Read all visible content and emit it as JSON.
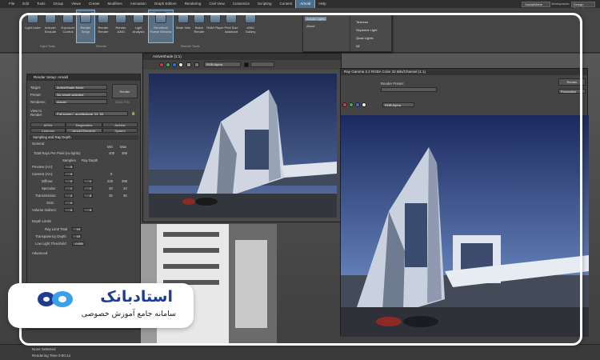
{
  "menubar": {
    "items": [
      "File",
      "Edit",
      "Tools",
      "Group",
      "Views",
      "Create",
      "Modifiers",
      "Animation",
      "Graph Editors",
      "Rendering",
      "Civil View",
      "Customize",
      "Scripting",
      "Content",
      "Arnold",
      "Help"
    ],
    "active_item": "Arnold",
    "user": "VastakMahe",
    "workspaces_label": "Workspaces:",
    "workspace": "Design Default"
  },
  "ribbon": {
    "buttons": [
      "Light Lister",
      "Include/ Exclude",
      "Exposure Control",
      "Render Setup",
      "Render Render",
      "Render A360",
      "Light Analysis",
      "Rendered Frame Window",
      "State Sets",
      "Batch Render",
      "RAM Player",
      "Print Size Assistant",
      "A360 Gallery"
    ],
    "groups": [
      "Light Tools",
      "Render",
      "Render Tools"
    ]
  },
  "arnold_menu": {
    "left": [
      "Arnold Lights",
      "About"
    ],
    "right": [
      "Textures",
      "Skydome Light",
      "Quad Lights",
      "All"
    ]
  },
  "render_setup": {
    "title": "Render Setup: Arnold",
    "target_label": "Target:",
    "target_value": "ActiveShade Mode",
    "preset_label": "Preset:",
    "preset_value": "No preset selected",
    "renderer_label": "Renderer:",
    "renderer_value": "Arnold",
    "render_button": "Render",
    "save_file": "Save File",
    "view_label": "View to Render:",
    "view_value": "Full screen - architectural_01_00",
    "tabs_row1": [
      "AOVs",
      "Diagnostics",
      "Archive"
    ],
    "tabs_row2": [
      "Common",
      "Arnold Renderer",
      "System"
    ],
    "sampling_header": "Sampling and Ray Depth",
    "general_label": "General",
    "min_label": "Min",
    "max_label": "Max",
    "total_rays_label": "Total Rays Per Pixel (no lights)",
    "total_min": "400",
    "total_max": "486",
    "samples_label": "Samples",
    "ray_depth_label": "Ray Depth",
    "rows": [
      {
        "label": "Preview (AA):",
        "samples": "-3",
        "depth": ""
      },
      {
        "label": "Camera (AA):",
        "samples": "3",
        "depth": "",
        "extra": "9"
      },
      {
        "label": "Diffuse:",
        "samples": "2",
        "depth": "1",
        "a": "225",
        "b": "396"
      },
      {
        "label": "Specular:",
        "samples": "1",
        "depth": "1",
        "a": "49",
        "b": "44"
      },
      {
        "label": "Transmission:",
        "samples": "2",
        "depth": "8",
        "a": "36",
        "b": "36"
      },
      {
        "label": "SSS:",
        "samples": "2",
        "depth": "",
        "a": "",
        "b": ""
      },
      {
        "label": "Volume Indirect:",
        "samples": "2",
        "depth": "0",
        "a": "",
        "b": ""
      }
    ],
    "depth_limits_header": "Depth Limits",
    "ray_limit_label": "Ray Limit Total",
    "ray_limit": "10",
    "transparency_label": "Transparency Depth",
    "transparency": "10",
    "low_light_label": "Low Light Threshold",
    "low_light": "0.001",
    "advanced_label": "Advanced"
  },
  "activeshade": {
    "title": "ActiveShade (1:1)",
    "channel": "RGB Alpha"
  },
  "framebuffer": {
    "title": "Ray Gamma 2.2  RGBA Color 32 Bits/Channel (1:1)",
    "render_preset_label": "Render Preset:",
    "render_button": "Render",
    "production": "Production",
    "channel": "RGB Alpha"
  },
  "statusbar": {
    "selection": "None Selected",
    "rendering_time": "Rendering Time  0:00:14"
  },
  "logo": {
    "title": "استادبانک",
    "subtitle": "سامانه جامع آموزش خصوصی",
    "brand_blue": "#1f3b95",
    "brand_light": "#3aa0e8"
  }
}
